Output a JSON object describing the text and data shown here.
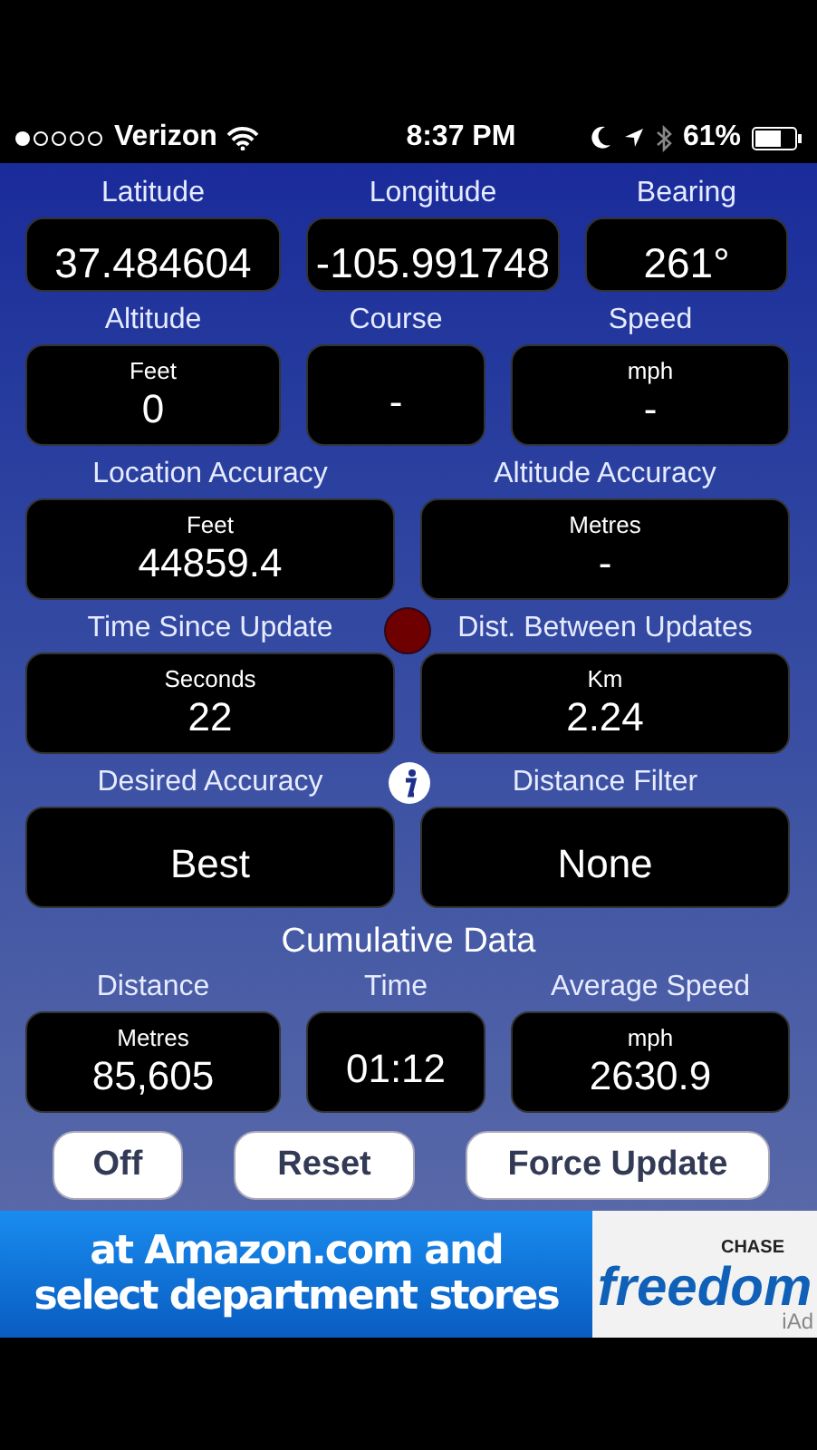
{
  "status_bar": {
    "carrier": "Verizon",
    "time": "8:37 PM",
    "battery": "61%"
  },
  "rows": [
    {
      "kind": "top",
      "fields": [
        {
          "label": "Latitude",
          "value": "37.484604"
        },
        {
          "label": "Longitude",
          "value": "-105.991748"
        },
        {
          "label": "Bearing",
          "value": "261°"
        }
      ]
    },
    {
      "kind": "three",
      "fields": [
        {
          "label": "Altitude",
          "unit": "Feet",
          "value": "0"
        },
        {
          "label": "Course",
          "value": "-"
        },
        {
          "label": "Speed",
          "unit": "mph",
          "value": "-"
        }
      ]
    },
    {
      "kind": "two",
      "fields": [
        {
          "label": "Location Accuracy",
          "unit": "Feet",
          "value": "44859.4"
        },
        {
          "label": "Altitude Accuracy",
          "unit": "Metres",
          "value": "-"
        }
      ]
    },
    {
      "kind": "two",
      "status_light": true,
      "fields": [
        {
          "label": "Time Since Update",
          "unit": "Seconds",
          "value": "22"
        },
        {
          "label": "Dist. Between Updates",
          "unit": "Km",
          "value": "2.24"
        }
      ]
    },
    {
      "kind": "two",
      "info_button": true,
      "fields": [
        {
          "label": "Desired Accuracy",
          "value": "Best"
        },
        {
          "label": "Distance Filter",
          "value": "None"
        }
      ]
    },
    {
      "kind": "heading",
      "title": "Cumulative Data"
    },
    {
      "kind": "three",
      "fields": [
        {
          "label": "Distance",
          "unit": "Metres",
          "value": "85,605"
        },
        {
          "label": "Time",
          "value": "01:12"
        },
        {
          "label": "Average Speed",
          "unit": "mph",
          "value": "2630.9"
        }
      ]
    }
  ],
  "buttons": [
    "Off",
    "Reset",
    "Force Update"
  ],
  "ad": {
    "text": "at Amazon.com and select department stores",
    "brand_top": "CHASE",
    "brand": "freedom",
    "tag": "iAd"
  }
}
